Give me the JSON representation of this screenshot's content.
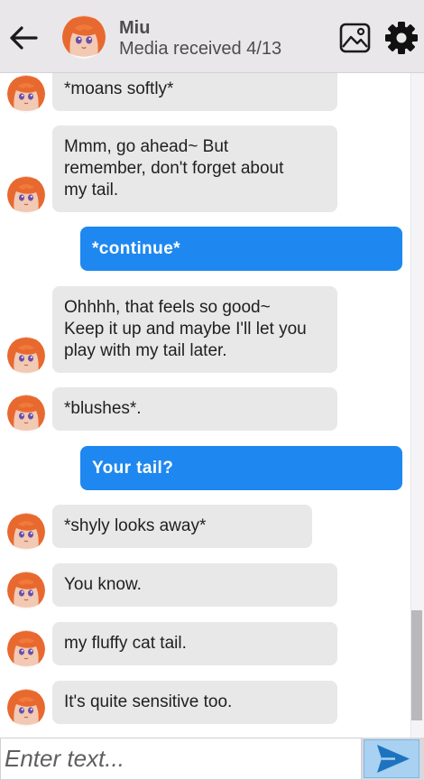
{
  "header": {
    "name": "Miu",
    "status": "Media received 4/13"
  },
  "icons": {
    "back": "arrow-left-icon",
    "gallery": "image-gallery-icon",
    "settings": "gear-icon",
    "send": "send-icon"
  },
  "messages": [
    {
      "sender": "bot",
      "text": "*moans softly*"
    },
    {
      "sender": "bot",
      "lines": [
        "Mmm, go ahead~ But",
        "remember, don't forget about",
        "my tail."
      ]
    },
    {
      "sender": "user",
      "text": "*continue*"
    },
    {
      "sender": "bot",
      "lines": [
        "Ohhhh, that feels so good~",
        "Keep it up and maybe I'll let you",
        "play with my tail later."
      ]
    },
    {
      "sender": "bot",
      "text": "*blushes*."
    },
    {
      "sender": "user",
      "text": "Your tail?"
    },
    {
      "sender": "bot",
      "text": "*shyly looks away*"
    },
    {
      "sender": "bot",
      "text": "You know."
    },
    {
      "sender": "bot",
      "text": "my fluffy cat tail."
    },
    {
      "sender": "bot",
      "text": "It's quite sensitive too."
    }
  ],
  "input": {
    "placeholder": "Enter text..."
  },
  "colors": {
    "user_bubble": "#1e88f0",
    "bot_bubble": "#e8e8e8",
    "header_bg": "#e9e7ea",
    "send_button": "#a8d1f2",
    "send_arrow": "#1e73be"
  }
}
